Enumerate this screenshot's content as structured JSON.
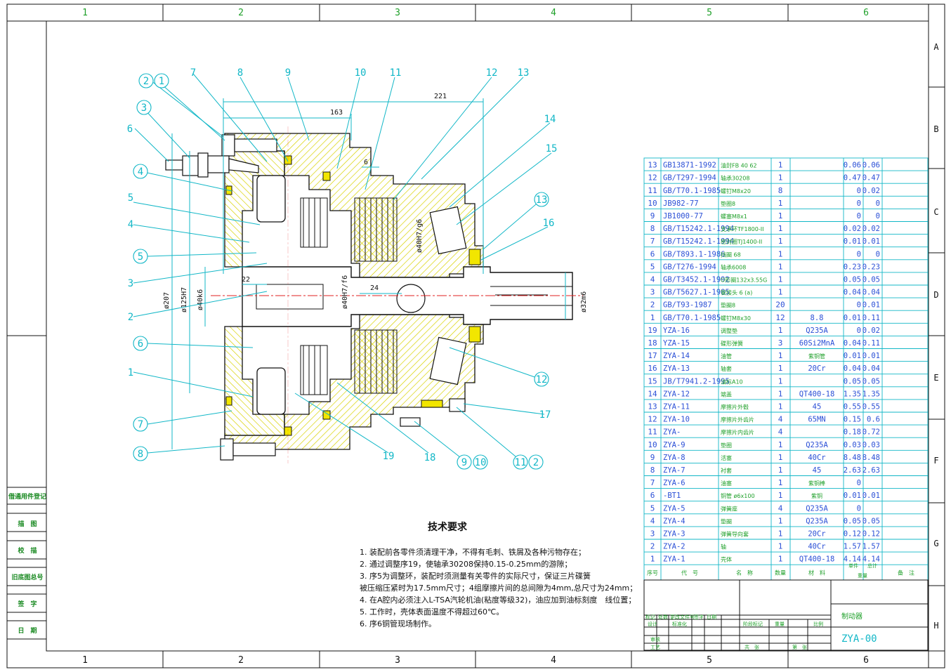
{
  "border": {
    "columns": [
      "1",
      "2",
      "3",
      "4",
      "5",
      "6"
    ],
    "rows": [
      "A",
      "B",
      "C",
      "D",
      "E",
      "F",
      "G",
      "H"
    ]
  },
  "balloons": {
    "b2a": "2",
    "b1a": "1",
    "b3": "3",
    "b6a": "6",
    "b4a": "4",
    "b5a": "5",
    "b4b": "4",
    "b5b": "5",
    "b3b": "3",
    "b2b": "2",
    "b6b": "6",
    "b1b": "1",
    "b7b": "7",
    "b8": "8",
    "b7": "7",
    "b8t": "8",
    "b9": "9",
    "b10": "10",
    "b11": "11",
    "b12": "12",
    "b13": "13",
    "b14": "14",
    "b15": "15",
    "b13r": "13",
    "b16": "16",
    "b12r": "12",
    "b17": "17",
    "b19": "19",
    "b18": "18",
    "b9b": "9",
    "b10b": "10",
    "b11b": "11",
    "b2c": "2"
  },
  "dims": {
    "d221": "221",
    "d163": "163",
    "d6": "6",
    "d22": "22",
    "d24": "24",
    "d207": "ø207",
    "d125": "ø125H7",
    "d40k": "ø40k6",
    "d32": "ø32m6",
    "d40h": "ø40H7/g6",
    "d7": "ø40H7/f6"
  },
  "bom": {
    "rows": [
      {
        "no": "13",
        "code": "GB13871-1992",
        "name": "油封FB 40 62",
        "qty": "1",
        "mat": "",
        "unit": "0.06",
        "total": "0.06"
      },
      {
        "no": "12",
        "code": "GB/T297-1994",
        "name": "轴承30208",
        "qty": "1",
        "mat": "",
        "unit": "0.47",
        "total": "0.47"
      },
      {
        "no": "11",
        "code": "GB/T70.1-1985",
        "name": "螺钉M8x20",
        "qty": "8",
        "mat": "",
        "unit": "0",
        "total": "0.02"
      },
      {
        "no": "10",
        "code": "JB982-77",
        "name": "垫圈8",
        "qty": "1",
        "mat": "",
        "unit": "0",
        "total": "0"
      },
      {
        "no": "9",
        "code": "JB1000-77",
        "name": "螺塞M8x1",
        "qty": "1",
        "mat": "",
        "unit": "0",
        "total": "0"
      },
      {
        "no": "8",
        "code": "GB/T15242.1-1994",
        "name": "支承环TF1800-II",
        "qty": "1",
        "mat": "",
        "unit": "0.02",
        "total": "0.02"
      },
      {
        "no": "7",
        "code": "GB/T15242.1-1994",
        "name": "密封圈TJ1400-II",
        "qty": "1",
        "mat": "",
        "unit": "0.01",
        "total": "0.01"
      },
      {
        "no": "6",
        "code": "GB/T893.1-1986",
        "name": "挡圈 68",
        "qty": "1",
        "mat": "",
        "unit": "0",
        "total": "0"
      },
      {
        "no": "5",
        "code": "GB/T276-1994",
        "name": "轴承6008",
        "qty": "1",
        "mat": "",
        "unit": "0.23",
        "total": "0.23"
      },
      {
        "no": "4",
        "code": "GB/T3452.1-1992",
        "name": "O形圈132x3.55G",
        "qty": "1",
        "mat": "",
        "unit": "0.05",
        "total": "0.05"
      },
      {
        "no": "3",
        "code": "GB/T5627.1-1985",
        "name": "管接头 6 (a)",
        "qty": "1",
        "mat": "",
        "unit": "0.04",
        "total": "0.04"
      },
      {
        "no": "2",
        "code": "GB/T93-1987",
        "name": "垫圈8",
        "qty": "20",
        "mat": "",
        "unit": "0",
        "total": "0.01"
      },
      {
        "no": "1",
        "code": "GB/T70.1-1985",
        "name": "螺钉M8x30",
        "qty": "12",
        "mat": "8.8",
        "unit": "0.01",
        "total": "0.11"
      },
      {
        "no": "19",
        "code": "YZA-16",
        "name": "调整垫",
        "qty": "1",
        "mat": "Q235A",
        "unit": "0",
        "total": "0.02"
      },
      {
        "no": "18",
        "code": "YZA-15",
        "name": "碟形弹簧",
        "qty": "3",
        "mat": "60Si2MnA",
        "unit": "0.04",
        "total": "0.11"
      },
      {
        "no": "17",
        "code": "ZYA-14",
        "name": "油管",
        "qty": "1",
        "mat": "紫铜管",
        "unit": "0.01",
        "total": "0.01"
      },
      {
        "no": "16",
        "code": "ZYA-13",
        "name": "轴套",
        "qty": "1",
        "mat": "20Cr",
        "unit": "0.04",
        "total": "0.04"
      },
      {
        "no": "15",
        "code": "JB/T7941.2-1995",
        "name": "油标A10",
        "qty": "1",
        "mat": "",
        "unit": "0.05",
        "total": "0.05"
      },
      {
        "no": "14",
        "code": "ZYA-12",
        "name": "端盖",
        "qty": "1",
        "mat": "QT400-18",
        "unit": "1.35",
        "total": "1.35"
      },
      {
        "no": "13",
        "code": "ZYA-11",
        "name": "摩擦片外毂",
        "qty": "1",
        "mat": "45",
        "unit": "0.55",
        "total": "0.55"
      },
      {
        "no": "12",
        "code": "ZYA-10",
        "name": "摩擦片外齿片",
        "qty": "4",
        "mat": "65MN",
        "unit": "0.15",
        "total": "0.6"
      },
      {
        "no": "11",
        "code": "ZYA-",
        "name": "摩擦片内齿片",
        "qty": "4",
        "mat": "",
        "unit": "0.18",
        "total": "0.72"
      },
      {
        "no": "10",
        "code": "ZYA-9",
        "name": "垫圈",
        "qty": "1",
        "mat": "Q235A",
        "unit": "0.03",
        "total": "0.03"
      },
      {
        "no": "9",
        "code": "ZYA-8",
        "name": "活塞",
        "qty": "1",
        "mat": "40Cr",
        "unit": "8.48",
        "total": "8.48"
      },
      {
        "no": "8",
        "code": "ZYA-7",
        "name": "衬套",
        "qty": "1",
        "mat": "45",
        "unit": "2.63",
        "total": "2.63"
      },
      {
        "no": "7",
        "code": "ZYA-6",
        "name": "油塞",
        "qty": "1",
        "mat": "紫铜棒",
        "unit": "0",
        "total": ""
      },
      {
        "no": "6",
        "code": "-BT1",
        "name": "铜管 ø6x100",
        "qty": "1",
        "mat": "紫铜",
        "unit": "0.01",
        "total": "0.01"
      },
      {
        "no": "5",
        "code": "ZYA-5",
        "name": "弹簧座",
        "qty": "4",
        "mat": "Q235A",
        "unit": "0",
        "total": ""
      },
      {
        "no": "4",
        "code": "ZYA-4",
        "name": "垫圈",
        "qty": "1",
        "mat": "Q235A",
        "unit": "0.05",
        "total": "0.05"
      },
      {
        "no": "3",
        "code": "ZYA-3",
        "name": "弹簧导向套",
        "qty": "1",
        "mat": "20Cr",
        "unit": "0.12",
        "total": "0.12"
      },
      {
        "no": "2",
        "code": "ZYA-2",
        "name": "轴",
        "qty": "1",
        "mat": "40Cr",
        "unit": "1.57",
        "total": "1.57"
      },
      {
        "no": "1",
        "code": "ZYA-1",
        "name": "壳体",
        "qty": "1",
        "mat": "QT400-18",
        "unit": "4.14",
        "total": "4.14"
      }
    ],
    "header": {
      "no": "序号",
      "code": "代　号",
      "name": "名　称",
      "qty": "数量",
      "mat": "材　料",
      "unit": "单件",
      "total": "总计",
      "weight": "重量",
      "remark": "备　注"
    }
  },
  "titleblock": {
    "part_name": "制动器",
    "drawing_no": "ZYA-00",
    "r1": "标记",
    "r1b": "处数",
    "r1c": "更改文件号",
    "r1d": "签字",
    "r1e": "日期",
    "design": "设计",
    "std": "标准化",
    "stage": "阶段标记",
    "weight": "重量",
    "scale": "比例",
    "review": "审核",
    "process": "工艺",
    "sheets": "共　张",
    "sheet": "第　张"
  },
  "side": {
    "s1": "借通用件登记",
    "s2": "描　图",
    "s3": "校　描",
    "s4": "旧底图总号",
    "s5": "签　字",
    "s6": "日　期"
  },
  "notes": {
    "title": "技术要求",
    "l1": "1. 装配前各零件须清理干净，不得有毛刺、铁屑及各种污物存在；",
    "l2": "2. 通过调整序19，使轴承30208保持0.15-0.25mm的游隙；",
    "l3": "3. 序5为调整环，装配时须测量有关零件的实际尺寸，保证三片碟簧",
    "l3b": "   被压缩压紧时为17.5mm尺寸；4组摩擦片间的总间隙为4mm,总尺寸为24mm；",
    "l4": "4. 在A腔内必须注入L-TSA汽轮机油(粘度等级32)，油应加到油标刻度　线位置；",
    "l5": "5. 工作时，壳体表面温度不得超过60℃。",
    "l6": "6. 序6铜管现场制作。"
  }
}
